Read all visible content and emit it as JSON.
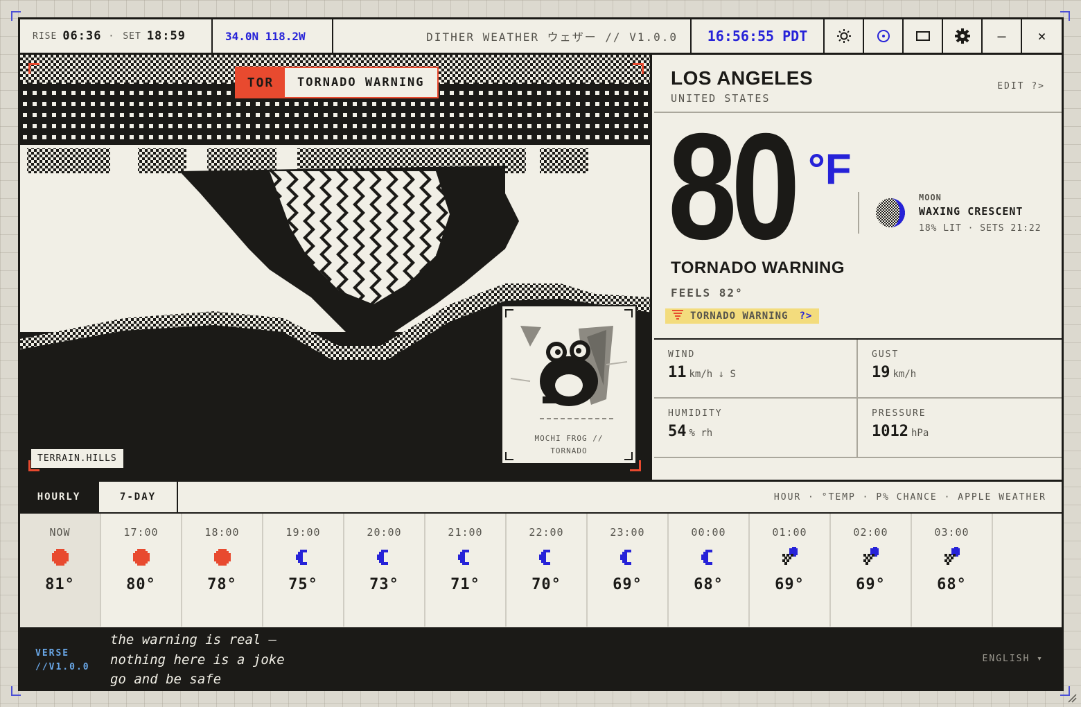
{
  "titlebar": {
    "rise_label": "RISE",
    "rise_time": "06:36",
    "separator": "·",
    "set_label": "SET",
    "set_time": "18:59",
    "coords": "34.0N 118.2W",
    "app_title": "DITHER WEATHER ウェザー // V1.0.0",
    "clock": "16:56:55 PDT",
    "icons": [
      "sun-icon",
      "target-icon",
      "window-icon",
      "gear-icon",
      "minimize-icon",
      "close-icon"
    ],
    "minimize_glyph": "–",
    "close_glyph": "×"
  },
  "map": {
    "alert_code": "TOR",
    "alert_text": "TORNADO WARNING",
    "terrain_label": "TERRAIN.HILLS",
    "sprite_caption_line1": "MOCHI FROG //",
    "sprite_caption_line2": "TORNADO"
  },
  "location": {
    "city": "LOS ANGELES",
    "country": "UNITED STATES",
    "edit": "EDIT ?>"
  },
  "current": {
    "temp": "80",
    "unit": "°F",
    "condition": "TORNADO WARNING",
    "feels": "FEELS 82°",
    "warning_pill": "TORNADO WARNING",
    "warning_more": "?>"
  },
  "moon": {
    "label": "MOON",
    "phase": "WAXING CRESCENT",
    "detail": "18% LIT · SETS 21:22",
    "illumination_fraction": 0.18
  },
  "stats": {
    "wind_label": "WIND",
    "wind_value": "11",
    "wind_unit": "km/h ↓ S",
    "gust_label": "GUST",
    "gust_value": "19",
    "gust_unit": "km/h",
    "humidity_label": "HUMIDITY",
    "humidity_value": "54",
    "humidity_unit": "% rh",
    "pressure_label": "PRESSURE",
    "pressure_value": "1012",
    "pressure_unit": "hPa"
  },
  "forecast": {
    "tabs": [
      "HOURLY",
      "7-DAY"
    ],
    "active_tab": "HOURLY",
    "legend": "HOUR · °TEMP · P% CHANCE · APPLE WEATHER",
    "hours": [
      {
        "time": "NOW",
        "icon": "sun",
        "temp": "81°"
      },
      {
        "time": "17:00",
        "icon": "sun",
        "temp": "80°"
      },
      {
        "time": "18:00",
        "icon": "sun",
        "temp": "78°"
      },
      {
        "time": "19:00",
        "icon": "moon",
        "temp": "75°"
      },
      {
        "time": "20:00",
        "icon": "moon",
        "temp": "73°"
      },
      {
        "time": "21:00",
        "icon": "moon",
        "temp": "71°"
      },
      {
        "time": "22:00",
        "icon": "moon",
        "temp": "70°"
      },
      {
        "time": "23:00",
        "icon": "moon",
        "temp": "69°"
      },
      {
        "time": "00:00",
        "icon": "moon",
        "temp": "68°"
      },
      {
        "time": "01:00",
        "icon": "cloud-moon",
        "temp": "69°"
      },
      {
        "time": "02:00",
        "icon": "cloud-moon",
        "temp": "69°"
      },
      {
        "time": "03:00",
        "icon": "cloud-moon",
        "temp": "68°"
      }
    ]
  },
  "footer": {
    "brand_line1": "VERSE",
    "brand_line2": "//V1.0.0",
    "poem": [
      "the warning is real —",
      "nothing here is a joke",
      "go and be safe"
    ],
    "language": "ENGLISH ▾"
  },
  "colors": {
    "ink": "#1b1a17",
    "paper": "#f1efe6",
    "accent_blue": "#2622d8",
    "alert_red": "#e84a2f",
    "warning_yellow": "#f3dc7d"
  }
}
